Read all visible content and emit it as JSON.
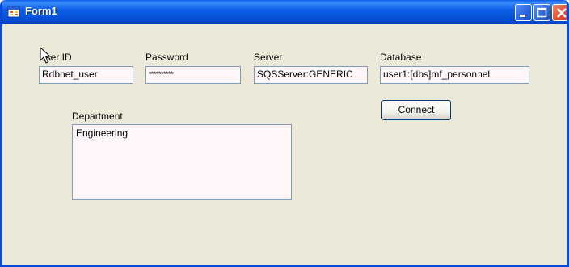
{
  "window": {
    "title": "Form1"
  },
  "icons": {
    "app": "form-app-icon",
    "minimize": "minimize-icon",
    "maximize": "maximize-icon",
    "close": "close-icon",
    "cursor": "mouse-pointer-icon"
  },
  "fields": {
    "user_id": {
      "label": "User ID",
      "value": "Rdbnet_user"
    },
    "password": {
      "label": "Password",
      "value": "**********"
    },
    "server": {
      "label": "Server",
      "value": "SQSServer:GENERIC"
    },
    "database": {
      "label": "Database",
      "value": "user1:[dbs]mf_personnel"
    },
    "department": {
      "label": "Department",
      "value": "Engineering"
    }
  },
  "buttons": {
    "connect": "Connect"
  },
  "colors": {
    "titlebar": "#0553d8",
    "form_bg": "#ece9d8",
    "textbox_bg": "#fff6f7",
    "textbox_border": "#7f9db9"
  }
}
